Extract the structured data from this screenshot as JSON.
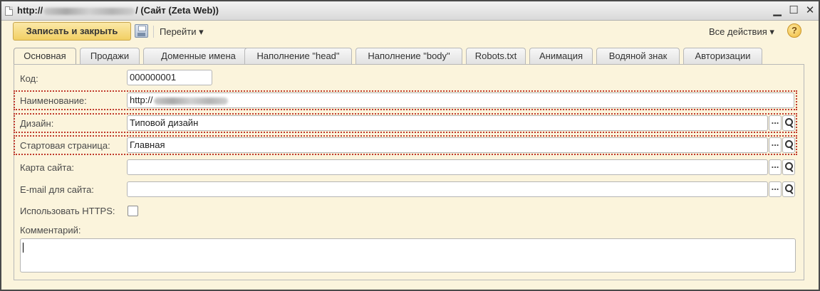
{
  "window": {
    "title_prefix": "http://",
    "title_suffix": "/ (Сайт (Zeta Web))",
    "minimize_glyph": "▁",
    "maximize_glyph": "☐",
    "close_glyph": "✕"
  },
  "toolbar": {
    "save_close_label": "Записать и закрыть",
    "save_icon": "save-icon",
    "goto_label": "Перейти ▾",
    "all_actions_label": "Все действия ▾",
    "help_label": "?"
  },
  "tabs": [
    {
      "label": "Основная",
      "active": true
    },
    {
      "label": "Продажи"
    },
    {
      "label": "Доменные имена"
    },
    {
      "label": "Наполнение \"head\""
    },
    {
      "label": "Наполнение \"body\""
    },
    {
      "label": "Robots.txt"
    },
    {
      "label": "Анимация"
    },
    {
      "label": "Водяной знак"
    },
    {
      "label": "Авторизации"
    }
  ],
  "form": {
    "code_label": "Код:",
    "code_value": "000000001",
    "name_label": "Наименование:",
    "name_value_prefix": "http://",
    "design_label": "Дизайн:",
    "design_value": "Типовой дизайн",
    "start_page_label": "Стартовая страница:",
    "start_page_value": "Главная",
    "sitemap_label": "Карта сайта:",
    "sitemap_value": "",
    "email_label": "E-mail для сайта:",
    "email_value": "",
    "https_label": "Использовать HTTPS:",
    "https_checked": false,
    "comment_label": "Комментарий:",
    "comment_value": "",
    "select_button_glyph": "...",
    "highlight_color": "#c0392b"
  }
}
